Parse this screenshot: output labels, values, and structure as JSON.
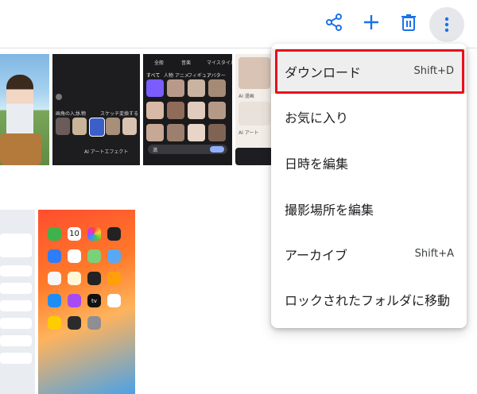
{
  "toolbar": {
    "icons": [
      "share-icon",
      "add-icon",
      "trash-icon",
      "more-vert-icon"
    ],
    "accent": "#1a73e8"
  },
  "menu": {
    "items": [
      {
        "label": "ダウンロード",
        "shortcut": "Shift+D"
      },
      {
        "label": "お気に入り",
        "shortcut": ""
      },
      {
        "label": "日時を編集",
        "shortcut": ""
      },
      {
        "label": "撮影場所を編集",
        "shortcut": ""
      },
      {
        "label": "アーカイブ",
        "shortcut": "Shift+A"
      },
      {
        "label": "ロックされたフォルダに移動",
        "shortcut": ""
      }
    ],
    "highlight_color": "#e8101a"
  },
  "gallery": {
    "t2_labels": [
      "画角の入力",
      "人物",
      "スケッチ",
      "変換する"
    ],
    "t2_caption": "AI アートエフェクト",
    "t3_tabs": [
      "全般",
      "音楽",
      "マイスタイル"
    ],
    "t3_filters": [
      "すべて",
      "人物",
      "アニメ",
      "フィギュア",
      "アバター"
    ],
    "t3_chip": "満",
    "t4_labels": [
      "AI 漫画",
      "AI アート"
    ],
    "t6_tile": "10",
    "t6_app": "tv"
  }
}
